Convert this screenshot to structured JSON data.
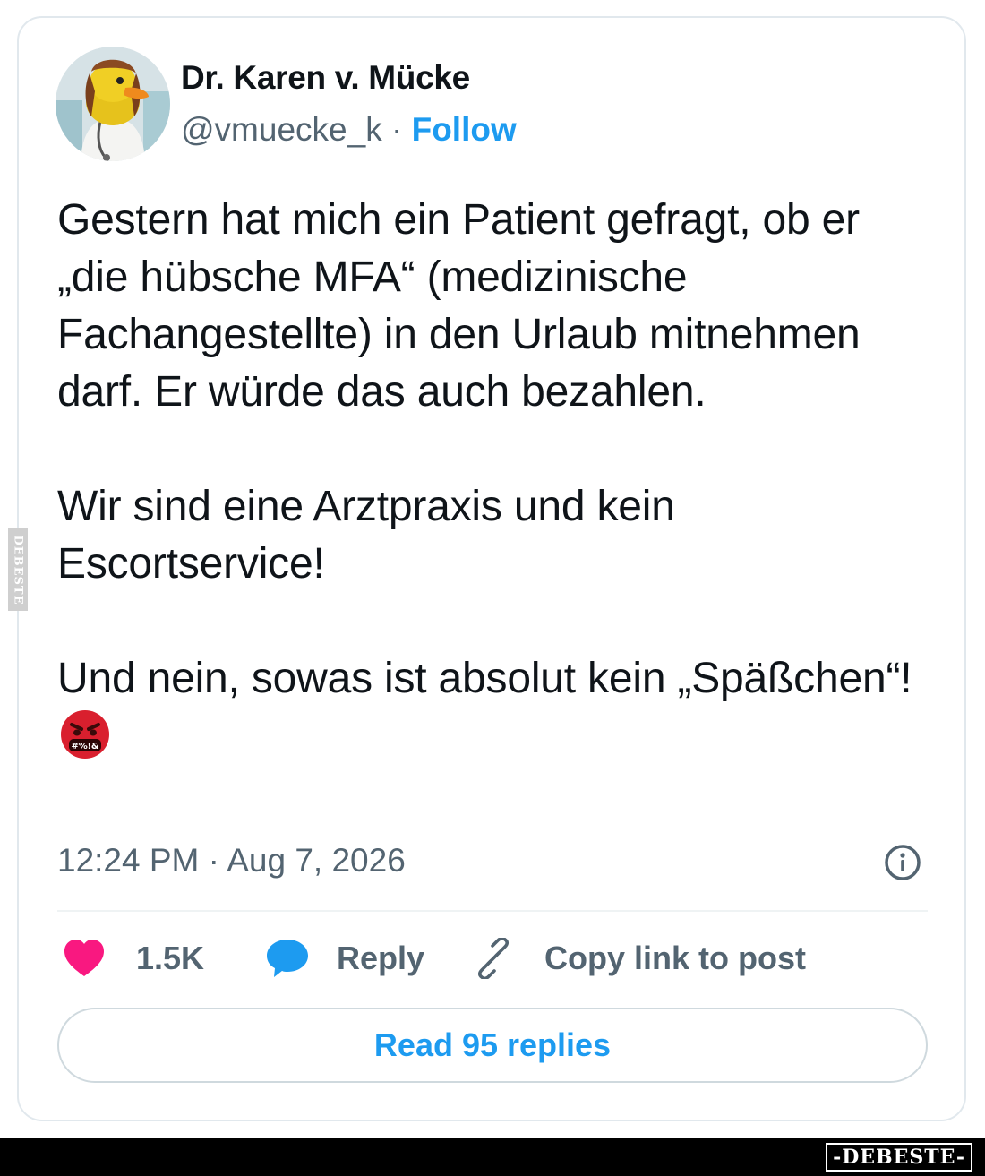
{
  "user": {
    "name": "Dr. Karen v. Mücke",
    "handle": "@vmuecke_k",
    "separator": " · ",
    "follow_label": "Follow"
  },
  "tweet": {
    "text": "Gestern hat mich ein Patient gefragt, ob er „die hübsche MFA“ (medizinische Fachangestellte) in den Urlaub mitnehmen darf. Er würde das auch bezahlen.\n\nWir sind eine Arztpraxis und kein Escortservice!\n\nUnd nein, sowas ist absolut kein „Späßchen“!",
    "emoji_name": "face-with-symbols-on-mouth-emoji",
    "timestamp": "12:24 PM · Aug 7, 2026"
  },
  "actions": {
    "like_count": "1.5K",
    "reply_label": "Reply",
    "copy_label": "Copy link to post",
    "read_replies_label": "Read 95 replies"
  },
  "icons": {
    "like": "heart-icon",
    "reply": "speech-bubble-icon",
    "copy": "link-icon",
    "info": "info-icon"
  },
  "colors": {
    "like": "#f91880",
    "reply": "#1d9bf0",
    "accent": "#1d9bf0",
    "text": "#0f1419",
    "secondary": "#536471"
  },
  "watermark": {
    "side": "DEBESTE",
    "bottom": "-DEBESTE-"
  }
}
